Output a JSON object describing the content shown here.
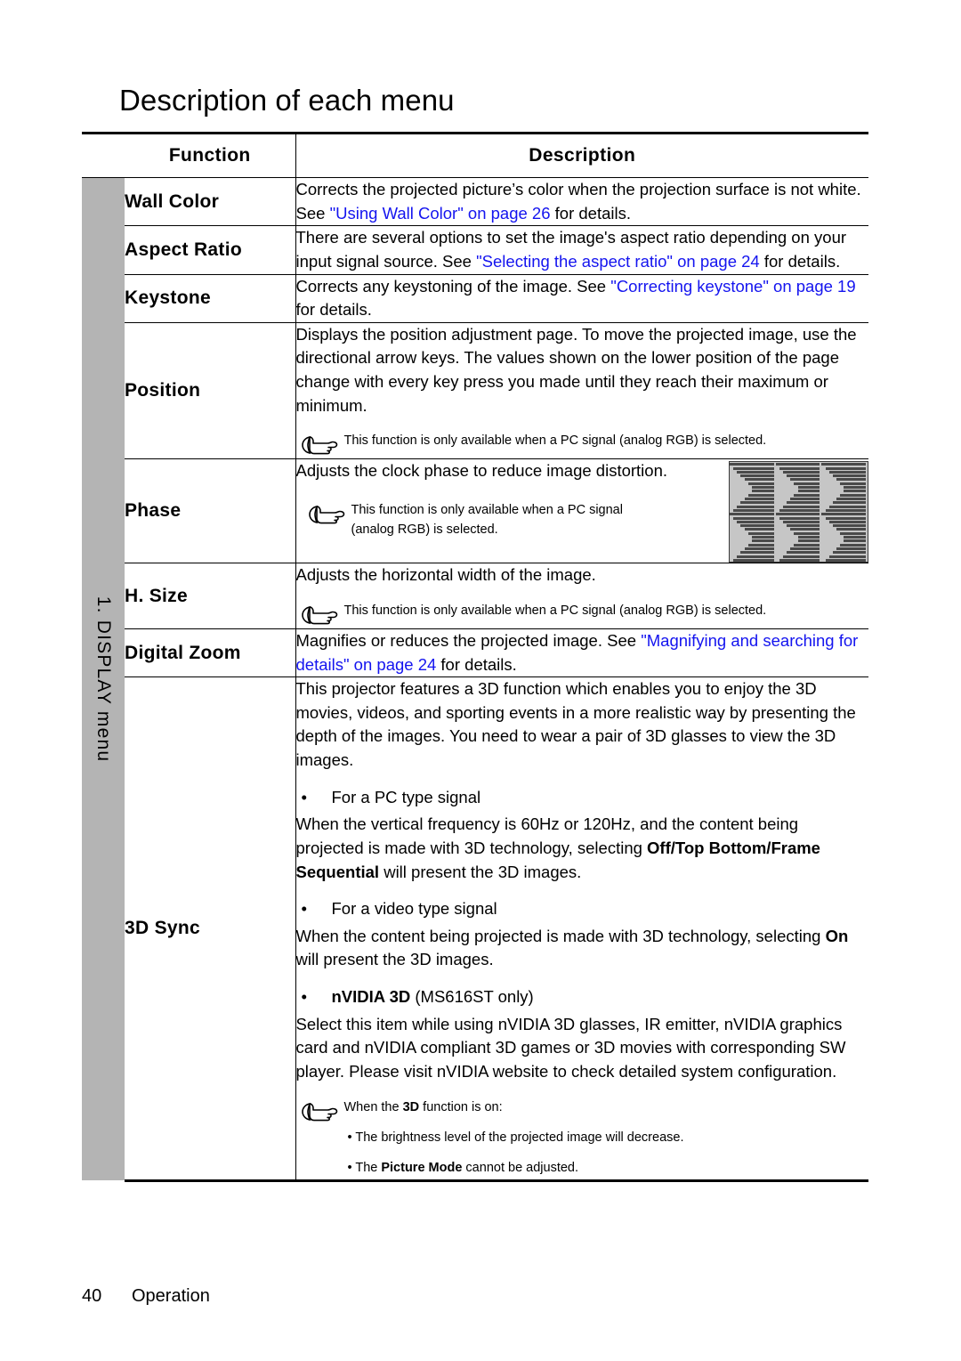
{
  "page": {
    "title": "Description of each menu",
    "footer_page_number": "40",
    "footer_section": "Operation",
    "link_color": "#1414ef",
    "rail_color": "#b4b4b4"
  },
  "rail": {
    "label": "1. DISPLAY menu"
  },
  "table": {
    "headers": {
      "function": "Function",
      "description": "Description"
    },
    "rows": [
      {
        "function": "Wall Color",
        "description": {
          "pre": "Corrects the projected picture’s color when the projection surface is not white. See ",
          "link": "\"Using Wall Color\" on page 26",
          "post": " for details."
        }
      },
      {
        "function": "Aspect Ratio",
        "description": {
          "pre": "There are several options to set the image's aspect ratio depending on your input signal source. See ",
          "link": "\"Selecting the aspect ratio\" on page 24",
          "post": " for details."
        }
      },
      {
        "function": "Keystone",
        "description": {
          "pre": "Corrects any keystoning of the image. See ",
          "link": "\"Correcting keystone\" on page 19",
          "post": " for details."
        }
      },
      {
        "function": "Position",
        "description": {
          "body": "Displays the position adjustment page. To move the projected image, use the directional arrow keys. The values shown on the lower position of the page change with every key press you made until they reach their maximum or minimum."
        },
        "note": {
          "text": "This function is only available when a PC signal (analog RGB) is selected."
        }
      },
      {
        "function": "Phase",
        "description": {
          "body": "Adjusts the clock phase to reduce image distortion."
        },
        "note": {
          "text": "This function is only available when a PC signal (analog RGB) is selected."
        },
        "figure": {
          "name": "phase-sample-image"
        }
      },
      {
        "function": "H. Size",
        "description": {
          "body": "Adjusts the horizontal width of the image."
        },
        "note": {
          "text": "This function is only available when a PC signal (analog RGB) is selected."
        }
      },
      {
        "function": "Digital Zoom",
        "description": {
          "pre": "Magnifies or reduces the projected image. See ",
          "link": "\"Magnifying and searching for details\" on page 24",
          "post": " for details."
        }
      },
      {
        "function": "3D Sync",
        "description": {
          "intro": "This projector features a 3D function which enables you to enjoy the 3D movies, videos, and sporting events in a more realistic way by presenting the depth of the images. You need to wear a pair of 3D glasses to view the 3D images.",
          "bullet1": "For a PC type signal",
          "para1_a": "When the vertical frequency is 60Hz or 120Hz, and the content being projected is made with 3D technology, selecting ",
          "para1_bold": "Off/Top Bottom/Frame Sequential",
          "para1_b": " will present the 3D images.",
          "bullet2": "For a video type signal",
          "para2_a": "When the content being projected is made with 3D technology, selecting ",
          "para2_bold": "On",
          "para2_b": " will present the 3D images.",
          "bullet3_bold": "nVIDIA 3D",
          "bullet3_rest": " (MS616ST only)",
          "para3": "Select this item while using nVIDIA 3D glasses, IR emitter, nVIDIA graphics card and nVIDIA compliant 3D games or 3D movies with corresponding SW player. Please visit nVIDIA website to check detailed system configuration."
        },
        "note": {
          "lead_a": "When the ",
          "lead_bold": "3D",
          "lead_b": " function is on:",
          "item1": "• The brightness level of the projected image will decrease.",
          "item2_a": "•  The ",
          "item2_bold": "Picture Mode",
          "item2_b": " cannot be adjusted."
        }
      }
    ]
  },
  "icons": {
    "note": "pointing-hand-icon"
  }
}
